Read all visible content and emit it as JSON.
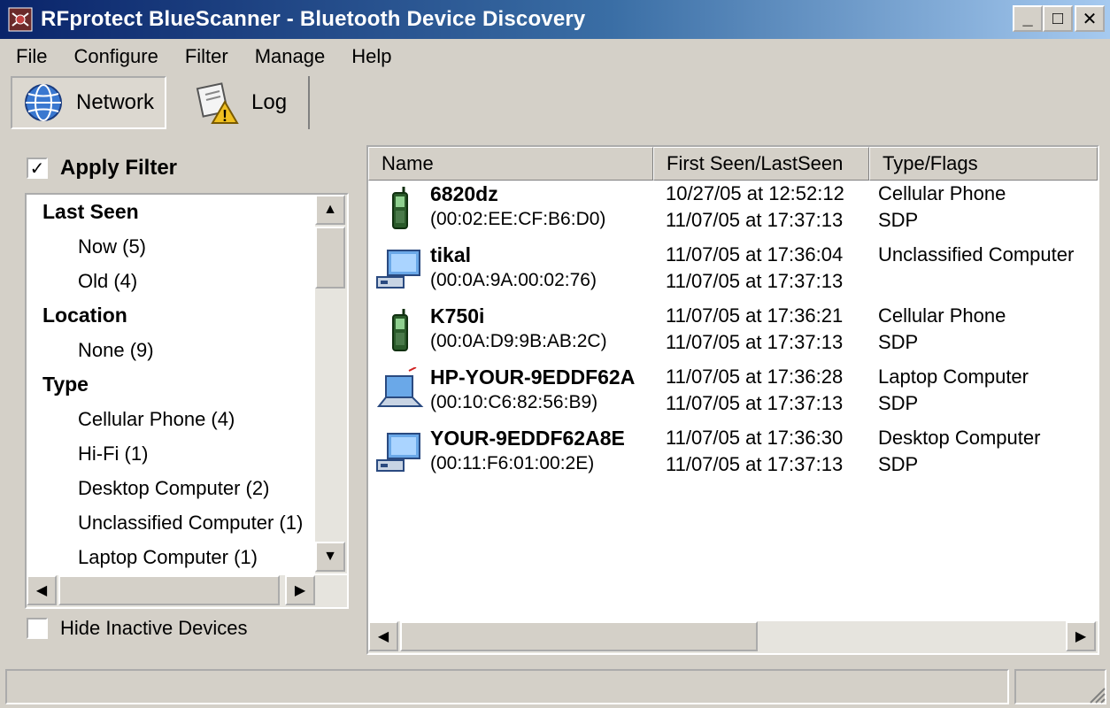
{
  "window": {
    "title": "RFprotect BlueScanner - Bluetooth Device Discovery",
    "controls": {
      "minimize": "_",
      "maximize": "□",
      "close": "✕"
    }
  },
  "menu": [
    "File",
    "Configure",
    "Filter",
    "Manage",
    "Help"
  ],
  "toolbar": {
    "network_label": "Network",
    "log_label": "Log"
  },
  "filter": {
    "apply_label": "Apply Filter",
    "apply_checked": true,
    "hide_inactive_label": "Hide Inactive Devices",
    "hide_inactive_checked": false,
    "tree": [
      {
        "kind": "group",
        "label": "Last Seen"
      },
      {
        "kind": "leaf",
        "label": "Now (5)"
      },
      {
        "kind": "leaf",
        "label": "Old (4)"
      },
      {
        "kind": "group",
        "label": "Location"
      },
      {
        "kind": "leaf",
        "label": "None (9)"
      },
      {
        "kind": "group",
        "label": "Type"
      },
      {
        "kind": "leaf",
        "label": "Cellular Phone (4)"
      },
      {
        "kind": "leaf",
        "label": "Hi-Fi (1)"
      },
      {
        "kind": "leaf",
        "label": "Desktop Computer (2)"
      },
      {
        "kind": "leaf",
        "label": "Unclassified Computer (1)"
      },
      {
        "kind": "leaf",
        "label": "Laptop Computer (1)"
      }
    ]
  },
  "device_list": {
    "columns": [
      "Name",
      "First Seen/LastSeen",
      "Type/Flags"
    ],
    "rows": [
      {
        "icon": "cellphone-icon",
        "name": "6820dz",
        "mac": "(00:02:EE:CF:B6:D0)",
        "first_seen": "10/27/05 at 12:52:12",
        "last_seen": "11/07/05 at 17:37:13",
        "type": "Cellular Phone",
        "flags": "SDP"
      },
      {
        "icon": "desktop-computer-icon",
        "name": "tikal",
        "mac": "(00:0A:9A:00:02:76)",
        "first_seen": "11/07/05 at 17:36:04",
        "last_seen": "11/07/05 at 17:37:13",
        "type": "Unclassified Computer",
        "flags": ""
      },
      {
        "icon": "cellphone-icon",
        "name": "K750i",
        "mac": "(00:0A:D9:9B:AB:2C)",
        "first_seen": "11/07/05 at 17:36:21",
        "last_seen": "11/07/05 at 17:37:13",
        "type": "Cellular Phone",
        "flags": "SDP"
      },
      {
        "icon": "laptop-computer-icon",
        "name": "HP-YOUR-9EDDF62A",
        "mac": "(00:10:C6:82:56:B9)",
        "first_seen": "11/07/05 at 17:36:28",
        "last_seen": "11/07/05 at 17:37:13",
        "type": "Laptop Computer",
        "flags": "SDP"
      },
      {
        "icon": "desktop-computer-icon",
        "name": "YOUR-9EDDF62A8E",
        "mac": "(00:11:F6:01:00:2E)",
        "first_seen": "11/07/05 at 17:36:30",
        "last_seen": "11/07/05 at 17:37:13",
        "type": "Desktop Computer",
        "flags": "SDP"
      }
    ]
  },
  "colors": {
    "title_start": "#0a246a",
    "title_end": "#a6caf0",
    "face": "#d4d0c8"
  }
}
